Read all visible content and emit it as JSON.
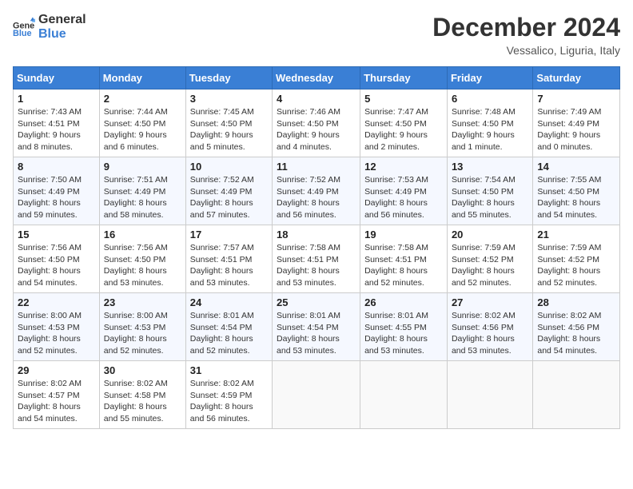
{
  "header": {
    "logo_line1": "General",
    "logo_line2": "Blue",
    "month": "December 2024",
    "location": "Vessalico, Liguria, Italy"
  },
  "weekdays": [
    "Sunday",
    "Monday",
    "Tuesday",
    "Wednesday",
    "Thursday",
    "Friday",
    "Saturday"
  ],
  "weeks": [
    [
      {
        "day": 1,
        "rise": "7:43 AM",
        "set": "4:51 PM",
        "daylight": "9 hours and 8 minutes."
      },
      {
        "day": 2,
        "rise": "7:44 AM",
        "set": "4:50 PM",
        "daylight": "9 hours and 6 minutes."
      },
      {
        "day": 3,
        "rise": "7:45 AM",
        "set": "4:50 PM",
        "daylight": "9 hours and 5 minutes."
      },
      {
        "day": 4,
        "rise": "7:46 AM",
        "set": "4:50 PM",
        "daylight": "9 hours and 4 minutes."
      },
      {
        "day": 5,
        "rise": "7:47 AM",
        "set": "4:50 PM",
        "daylight": "9 hours and 2 minutes."
      },
      {
        "day": 6,
        "rise": "7:48 AM",
        "set": "4:50 PM",
        "daylight": "9 hours and 1 minute."
      },
      {
        "day": 7,
        "rise": "7:49 AM",
        "set": "4:49 PM",
        "daylight": "9 hours and 0 minutes."
      }
    ],
    [
      {
        "day": 8,
        "rise": "7:50 AM",
        "set": "4:49 PM",
        "daylight": "8 hours and 59 minutes."
      },
      {
        "day": 9,
        "rise": "7:51 AM",
        "set": "4:49 PM",
        "daylight": "8 hours and 58 minutes."
      },
      {
        "day": 10,
        "rise": "7:52 AM",
        "set": "4:49 PM",
        "daylight": "8 hours and 57 minutes."
      },
      {
        "day": 11,
        "rise": "7:52 AM",
        "set": "4:49 PM",
        "daylight": "8 hours and 56 minutes."
      },
      {
        "day": 12,
        "rise": "7:53 AM",
        "set": "4:49 PM",
        "daylight": "8 hours and 56 minutes."
      },
      {
        "day": 13,
        "rise": "7:54 AM",
        "set": "4:50 PM",
        "daylight": "8 hours and 55 minutes."
      },
      {
        "day": 14,
        "rise": "7:55 AM",
        "set": "4:50 PM",
        "daylight": "8 hours and 54 minutes."
      }
    ],
    [
      {
        "day": 15,
        "rise": "7:56 AM",
        "set": "4:50 PM",
        "daylight": "8 hours and 54 minutes."
      },
      {
        "day": 16,
        "rise": "7:56 AM",
        "set": "4:50 PM",
        "daylight": "8 hours and 53 minutes."
      },
      {
        "day": 17,
        "rise": "7:57 AM",
        "set": "4:51 PM",
        "daylight": "8 hours and 53 minutes."
      },
      {
        "day": 18,
        "rise": "7:58 AM",
        "set": "4:51 PM",
        "daylight": "8 hours and 53 minutes."
      },
      {
        "day": 19,
        "rise": "7:58 AM",
        "set": "4:51 PM",
        "daylight": "8 hours and 52 minutes."
      },
      {
        "day": 20,
        "rise": "7:59 AM",
        "set": "4:52 PM",
        "daylight": "8 hours and 52 minutes."
      },
      {
        "day": 21,
        "rise": "7:59 AM",
        "set": "4:52 PM",
        "daylight": "8 hours and 52 minutes."
      }
    ],
    [
      {
        "day": 22,
        "rise": "8:00 AM",
        "set": "4:53 PM",
        "daylight": "8 hours and 52 minutes."
      },
      {
        "day": 23,
        "rise": "8:00 AM",
        "set": "4:53 PM",
        "daylight": "8 hours and 52 minutes."
      },
      {
        "day": 24,
        "rise": "8:01 AM",
        "set": "4:54 PM",
        "daylight": "8 hours and 52 minutes."
      },
      {
        "day": 25,
        "rise": "8:01 AM",
        "set": "4:54 PM",
        "daylight": "8 hours and 53 minutes."
      },
      {
        "day": 26,
        "rise": "8:01 AM",
        "set": "4:55 PM",
        "daylight": "8 hours and 53 minutes."
      },
      {
        "day": 27,
        "rise": "8:02 AM",
        "set": "4:56 PM",
        "daylight": "8 hours and 53 minutes."
      },
      {
        "day": 28,
        "rise": "8:02 AM",
        "set": "4:56 PM",
        "daylight": "8 hours and 54 minutes."
      }
    ],
    [
      {
        "day": 29,
        "rise": "8:02 AM",
        "set": "4:57 PM",
        "daylight": "8 hours and 54 minutes."
      },
      {
        "day": 30,
        "rise": "8:02 AM",
        "set": "4:58 PM",
        "daylight": "8 hours and 55 minutes."
      },
      {
        "day": 31,
        "rise": "8:02 AM",
        "set": "4:59 PM",
        "daylight": "8 hours and 56 minutes."
      },
      null,
      null,
      null,
      null
    ]
  ]
}
